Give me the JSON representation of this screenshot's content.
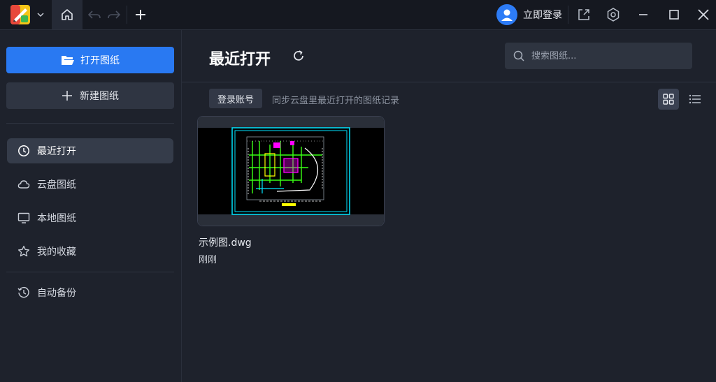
{
  "titlebar": {
    "login_label": "立即登录",
    "icons": [
      "app-logo-icon",
      "dropdown-arrow-icon",
      "home-icon",
      "undo-icon",
      "redo-icon",
      "plus-icon",
      "user-avatar-icon",
      "share-icon",
      "settings-icon",
      "minimize-icon",
      "maximize-icon",
      "close-icon"
    ]
  },
  "sidebar": {
    "open_button": "打开图纸",
    "new_button": "新建图纸",
    "items": [
      {
        "label": "最近打开",
        "icon": "clock-icon",
        "active": true
      },
      {
        "label": "云盘图纸",
        "icon": "cloud-icon",
        "active": false
      },
      {
        "label": "本地图纸",
        "icon": "monitor-icon",
        "active": false
      },
      {
        "label": "我的收藏",
        "icon": "star-icon",
        "active": false
      }
    ],
    "backup": {
      "label": "自动备份",
      "icon": "history-icon"
    }
  },
  "main": {
    "title": "最近打开",
    "search_placeholder": "搜索图纸...",
    "login_chip": "登录账号",
    "sync_text": "同步云盘里最近打开的图纸记录",
    "files": [
      {
        "name": "示例图.dwg",
        "time": "刚刚"
      }
    ]
  },
  "colors": {
    "accent": "#2979f2",
    "background": "#1e222c",
    "titlebar": "#151820",
    "active_item": "#353c4a"
  }
}
